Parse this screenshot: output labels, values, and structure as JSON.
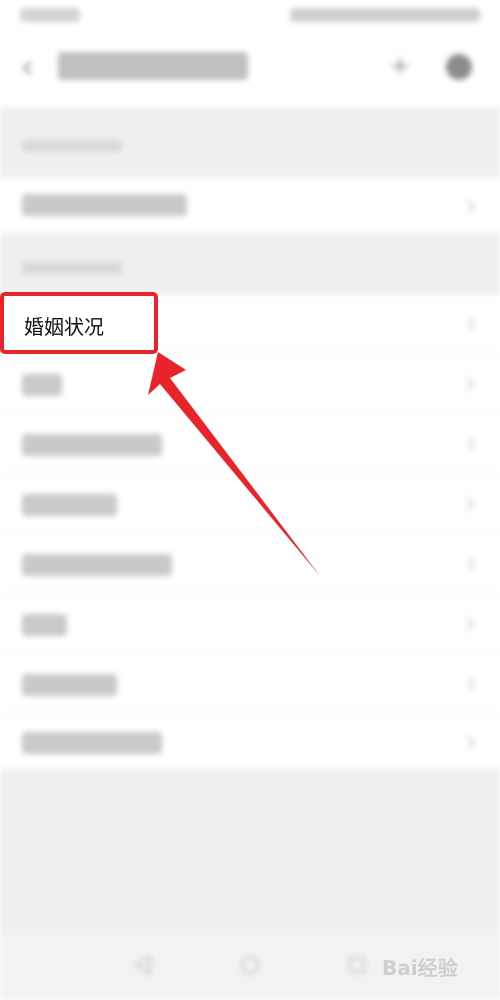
{
  "highlighted_item": {
    "label": "婚姻状况"
  },
  "watermark": {
    "text": "Bai经验"
  },
  "colors": {
    "highlight": "#e8242a",
    "background": "#efefef"
  },
  "icons": [
    "back-arrow-icon",
    "add-icon",
    "more-icon",
    "chevron-right-icon",
    "back-nav-icon",
    "home-nav-icon",
    "recents-nav-icon"
  ]
}
